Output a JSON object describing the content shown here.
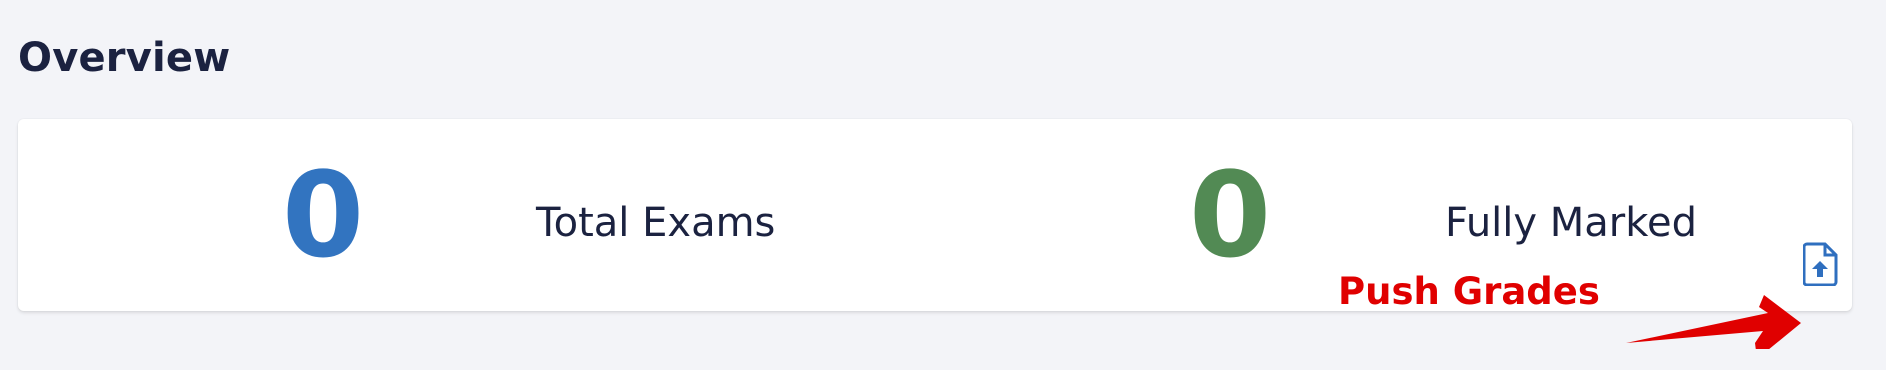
{
  "page": {
    "title": "Overview"
  },
  "stats": [
    {
      "value": "0",
      "label": "Total Exams",
      "color": "#3274c0"
    },
    {
      "value": "0",
      "label": "Fully Marked",
      "color": "#528a54"
    }
  ],
  "annotation": {
    "text": "Push Grades",
    "color": "#e00000"
  },
  "actions": {
    "push_grades_icon": "file-upload-icon",
    "icon_color": "#2f6fbf"
  }
}
